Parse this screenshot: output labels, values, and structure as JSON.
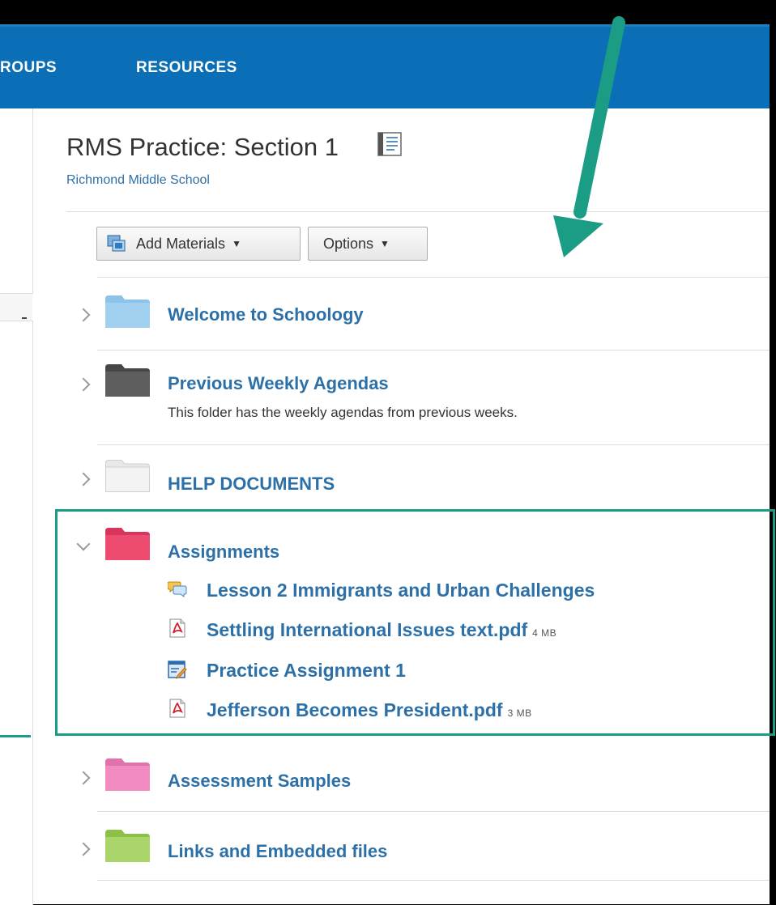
{
  "nav": {
    "groups": "ROUPS",
    "resources": "RESOURCES"
  },
  "course": {
    "title": "RMS Practice: Section 1",
    "school": "Richmond Middle School"
  },
  "toolbar": {
    "add_materials": "Add Materials",
    "options": "Options"
  },
  "folders": [
    {
      "title": "Welcome to Schoology",
      "color": "#8cc3ea"
    },
    {
      "title": "Previous Weekly Agendas",
      "description": "This folder has the weekly agendas from previous weeks.",
      "color": "#575757"
    },
    {
      "title": "HELP DOCUMENTS",
      "color": "#eeeeee"
    },
    {
      "title": "Assignments",
      "color": "#ee4b71"
    },
    {
      "title": "Assessment Samples",
      "color": "#f28cc0"
    },
    {
      "title": "Links and Embedded files",
      "color": "#a9d56b"
    }
  ],
  "assignments": [
    {
      "title": "Lesson 2 Immigrants and Urban Challenges",
      "icon": "discussion-icon"
    },
    {
      "title": "Settling International Issues text.pdf",
      "size": "4 MB",
      "icon": "pdf-icon"
    },
    {
      "title": "Practice Assignment 1",
      "icon": "assignment-icon"
    },
    {
      "title": "Jefferson Becomes President.pdf",
      "size": "3 MB",
      "icon": "pdf-icon"
    }
  ],
  "colors": {
    "nav_bg": "#0a6fb6",
    "link": "#2d70a7",
    "annotation": "#1a9d84"
  }
}
